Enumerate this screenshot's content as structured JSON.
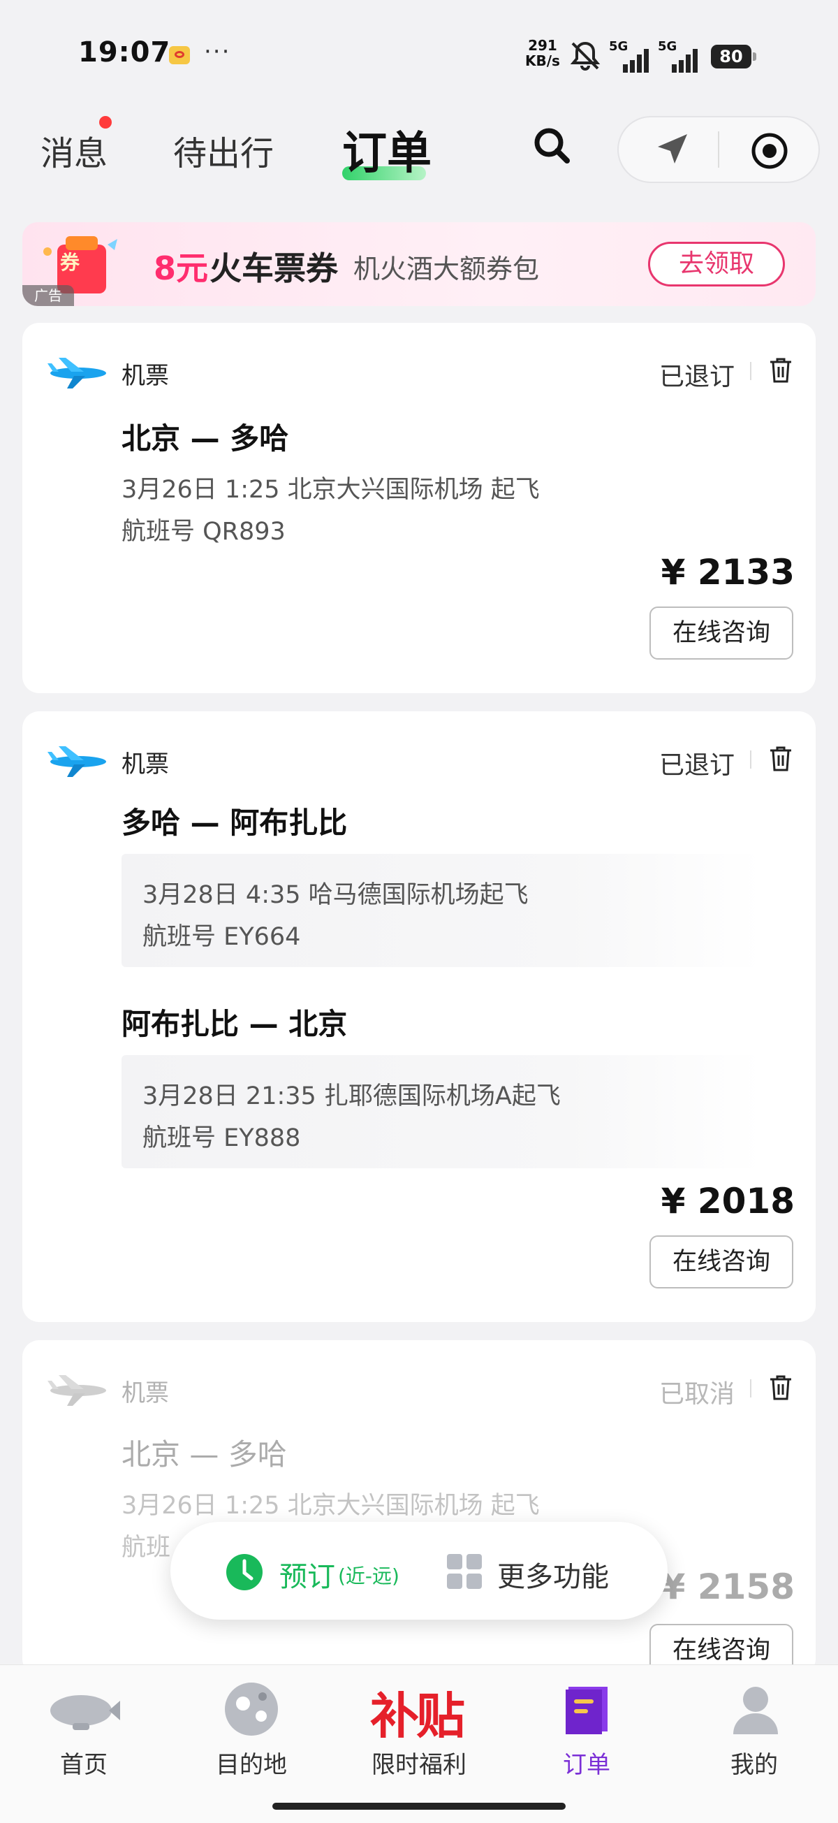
{
  "status_bar": {
    "time": "19:07",
    "dots": "···",
    "net_speed_value": "291",
    "net_speed_unit": "KB/s",
    "sim1_label": "5G",
    "sim2_label": "5G",
    "battery": "80"
  },
  "header": {
    "tabs": [
      {
        "label": "消息"
      },
      {
        "label": "待出行"
      },
      {
        "label": "订单"
      }
    ]
  },
  "ad": {
    "gift_text": "券",
    "tag": "广告",
    "title_highlight": "8元",
    "title_rest": "火车票券",
    "subtitle": "机火酒大额券包",
    "button": "去领取"
  },
  "orders": [
    {
      "type": "机票",
      "status": "已退订",
      "segments": [
        {
          "route": "北京 — 多哈",
          "line1": "3月26日 1:25 北京大兴国际机场 起飞",
          "line2": "航班号 QR893"
        }
      ],
      "price": "¥ 2133",
      "consult": "在线咨询"
    },
    {
      "type": "机票",
      "status": "已退订",
      "segments": [
        {
          "route": "多哈 — 阿布扎比",
          "line1": "3月28日 4:35 哈马德国际机场起飞",
          "line2": "航班号 EY664"
        },
        {
          "route": "阿布扎比 — 北京",
          "line1": "3月28日 21:35 扎耶德国际机场A起飞",
          "line2": "航班号 EY888"
        }
      ],
      "price": "¥ 2018",
      "consult": "在线咨询"
    },
    {
      "type": "机票",
      "status": "已取消",
      "segments": [
        {
          "route": "北京 — 多哈",
          "line1": "3月26日 1:25 北京大兴国际机场 起飞",
          "line2": "航班"
        }
      ],
      "price": "¥ 2158",
      "consult": "在线咨询"
    }
  ],
  "floating_bar": {
    "book_label": "预订",
    "book_sub": "(近-远)",
    "more_label": "更多功能"
  },
  "bottom_nav": {
    "butie_text": "补贴",
    "items": [
      {
        "label": "首页"
      },
      {
        "label": "目的地"
      },
      {
        "label": "限时福利"
      },
      {
        "label": "订单"
      },
      {
        "label": "我的"
      }
    ],
    "active_color": "#7b2fd6"
  },
  "colors": {
    "accent_green": "#19b95a",
    "ad_pink": "#e8366e",
    "nav_active": "#7b2fd6"
  }
}
